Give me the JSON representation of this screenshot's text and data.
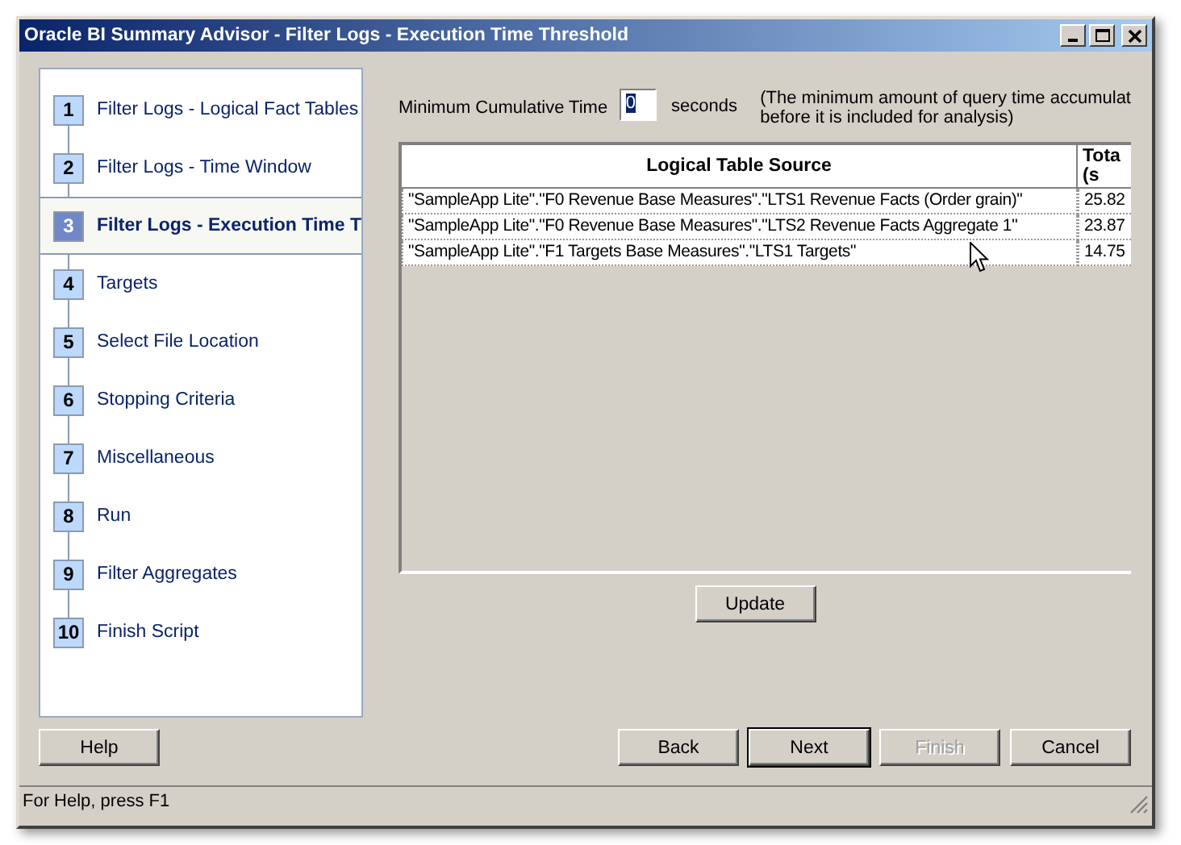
{
  "window": {
    "title": "Oracle BI Summary Advisor - Filter Logs - Execution Time Threshold"
  },
  "steps": [
    {
      "number": "1",
      "label": "Filter Logs - Logical Fact Tables",
      "selected": false
    },
    {
      "number": "2",
      "label": "Filter Logs - Time Window",
      "selected": false
    },
    {
      "number": "3",
      "label": "Filter Logs - Execution Time T",
      "selected": true
    },
    {
      "number": "4",
      "label": "Targets",
      "selected": false
    },
    {
      "number": "5",
      "label": "Select File Location",
      "selected": false
    },
    {
      "number": "6",
      "label": "Stopping Criteria",
      "selected": false
    },
    {
      "number": "7",
      "label": "Miscellaneous",
      "selected": false
    },
    {
      "number": "8",
      "label": "Run",
      "selected": false
    },
    {
      "number": "9",
      "label": "Filter Aggregates",
      "selected": false
    },
    {
      "number": "10",
      "label": "Finish Script",
      "selected": false
    }
  ],
  "threshold": {
    "label": "Minimum Cumulative Time",
    "value": "0",
    "unit": "seconds",
    "note": [
      "(The minimum amount of query time accumulat",
      "before it is included for analysis)"
    ]
  },
  "table": {
    "columns": [
      "Logical Table Source",
      "Tota (s"
    ],
    "rows": [
      [
        "\"SampleApp Lite\".\"F0 Revenue Base Measures\".\"LTS1 Revenue Facts (Order grain)\"",
        "25.82"
      ],
      [
        "\"SampleApp Lite\".\"F0 Revenue Base Measures\".\"LTS2 Revenue Facts Aggregate 1\"",
        "23.87"
      ],
      [
        "\"SampleApp Lite\".\"F1 Targets Base Measures\".\"LTS1 Targets\"",
        "14.75"
      ]
    ]
  },
  "update_button": {
    "label": "Update",
    "disabled": false
  },
  "help_button": {
    "label": "Help",
    "disabled": false
  },
  "nav_buttons": [
    {
      "label": "Back",
      "disabled": false,
      "default": false
    },
    {
      "label": "Next",
      "disabled": false,
      "default": true
    },
    {
      "label": "Finish",
      "disabled": true,
      "default": false
    },
    {
      "label": "Cancel",
      "disabled": false,
      "default": false
    }
  ],
  "status_bar": "For Help, press F1"
}
